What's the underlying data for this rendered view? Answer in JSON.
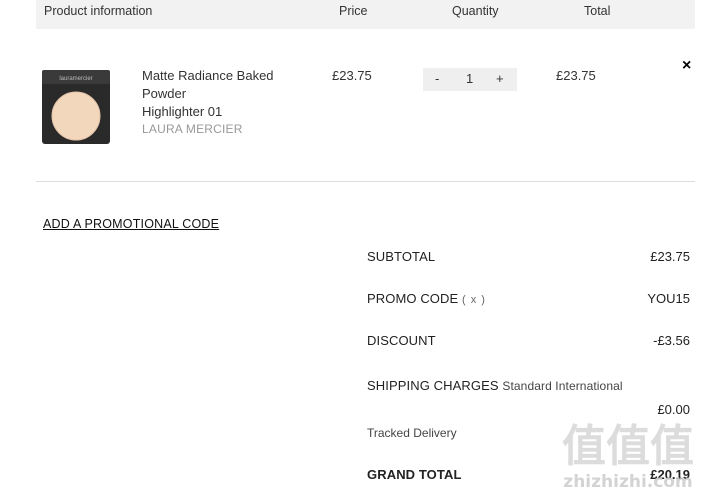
{
  "table_header": {
    "product": "Product information",
    "price": "Price",
    "quantity": "Quantity",
    "total": "Total"
  },
  "item": {
    "name_line1": "Matte Radiance Baked",
    "name_line2": "Powder",
    "name_line3": "Highlighter 01",
    "brand": "LAURA MERCIER",
    "thumb_brand": "lauramercier",
    "price": "£23.75",
    "qty_minus": "-",
    "quantity": "1",
    "qty_plus": "+",
    "total": "£23.75",
    "remove_symbol": "×"
  },
  "promo_link": "ADD A PROMOTIONAL CODE",
  "summary": {
    "subtotal_label": "SUBTOTAL",
    "subtotal_value": "£23.75",
    "promo_label": "PROMO CODE",
    "promo_remove": "( x )",
    "promo_value": "YOU15",
    "discount_label": "DISCOUNT",
    "discount_value": "-£3.56",
    "shipping_label": "SHIPPING CHARGES",
    "shipping_method": "Standard International",
    "shipping_value": "£0.00",
    "tracked": "Tracked Delivery",
    "grand_label": "GRAND TOTAL",
    "grand_value": "£20.19"
  },
  "watermark": {
    "glyphs": "值值值",
    "site": "zhizhizhi.com"
  },
  "colors": {
    "header_bg": "#f2f2f2",
    "stepper_bg": "#efefef",
    "brand_text": "#999999",
    "compact_case": "#2a2a2a",
    "powder": "#f3d7bd"
  }
}
